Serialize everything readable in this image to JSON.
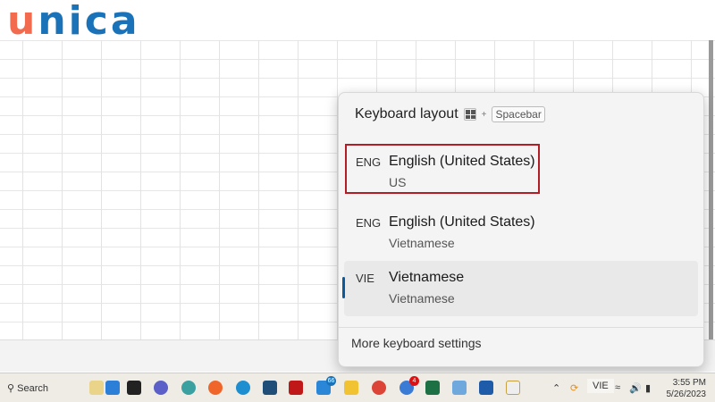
{
  "logo": {
    "first": "u",
    "rest": "nica"
  },
  "panel": {
    "title": "Keyboard layout",
    "shortcut_plus": "+",
    "shortcut_key": "Spacebar",
    "items": [
      {
        "code": "ENG",
        "name": "English (United States)",
        "sub": "US"
      },
      {
        "code": "ENG",
        "name": "English (United States)",
        "sub": "Vietnamese"
      },
      {
        "code": "VIE",
        "name": "Vietnamese",
        "sub": "Vietnamese"
      }
    ],
    "more": "More keyboard settings"
  },
  "taskbar": {
    "search": "Search",
    "mail_badge": "66",
    "chat_badge": "4",
    "lang": "VIE",
    "time": "3:55 PM",
    "date": "5/26/2023"
  },
  "colors": {
    "highlight": "#b21c24",
    "accent": "#0a5a9c"
  }
}
